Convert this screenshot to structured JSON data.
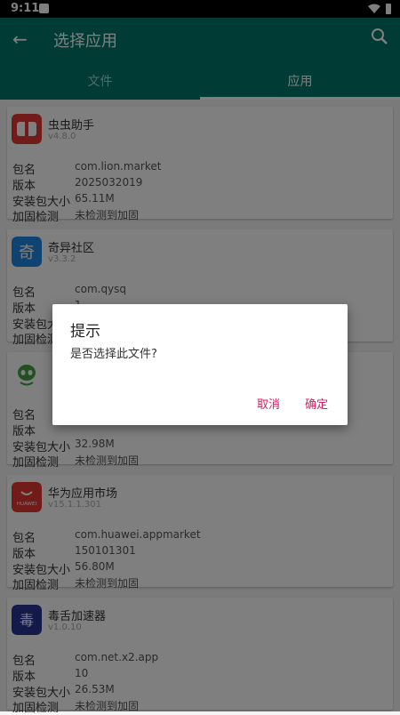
{
  "status": {
    "time": "9:11"
  },
  "appbar": {
    "title": "选择应用",
    "back_icon": "arrow-left-icon",
    "search_icon": "search-icon",
    "color": "#00796b"
  },
  "tabs": [
    {
      "label": "文件"
    },
    {
      "label": "应用"
    }
  ],
  "labels": {
    "pkg": "包名",
    "ver": "版本",
    "size": "安装包大小",
    "harden": "加固检测"
  },
  "apps": [
    {
      "name": "虫虫助手",
      "version": "v4.8.0",
      "package": "com.lion.market",
      "code": "2025032019",
      "size": "65.11M",
      "hardening": "未检测到加固"
    },
    {
      "name": "奇异社区",
      "version": "v3.3.2",
      "package": "com.qysq",
      "code": "1",
      "size": "",
      "hardening": ""
    },
    {
      "name": "",
      "version": "",
      "package": "",
      "code": "",
      "size": "32.98M",
      "hardening": "未检测到加固"
    },
    {
      "name": "华为应用市场",
      "version": "v15.1.1.301",
      "package": "com.huawei.appmarket",
      "code": "150101301",
      "size": "56.80M",
      "hardening": "未检测到加固"
    },
    {
      "name": "毒舌加速器",
      "version": "v1.0.10",
      "package": "com.net.x2.app",
      "code": "10",
      "size": "26.53M",
      "hardening": "未检测到加固"
    }
  ],
  "dialog": {
    "title": "提示",
    "message": "是否选择此文件?",
    "cancel": "取消",
    "ok": "确定"
  },
  "accent_color": "#d81b60"
}
